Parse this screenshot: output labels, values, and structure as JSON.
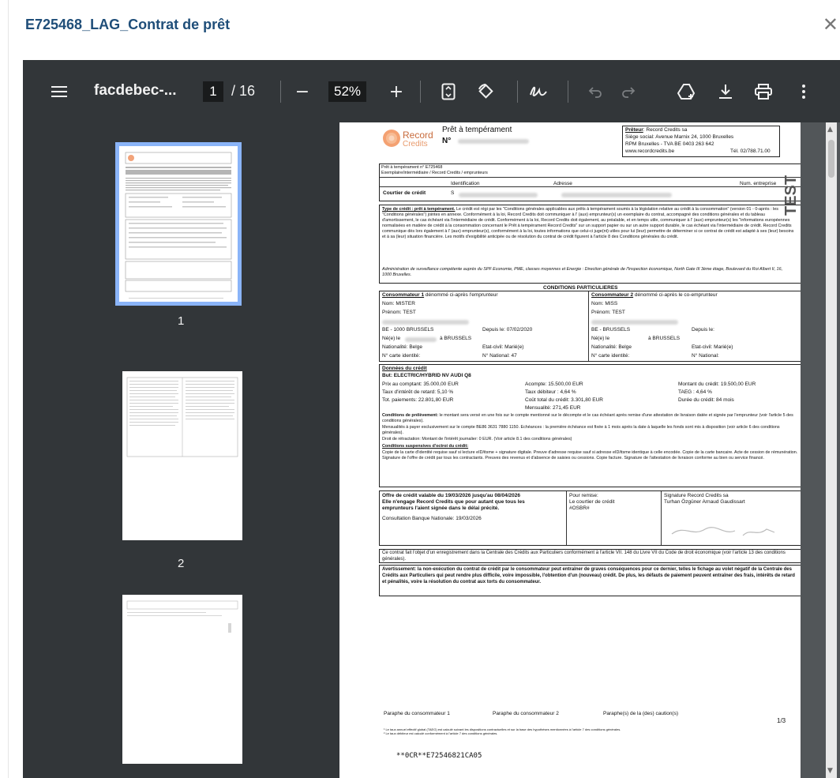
{
  "modal": {
    "title": "E725468_LAG_Contrat de prêt",
    "close_glyph": "✕"
  },
  "toolbar": {
    "menu_icon": "menu-icon",
    "file_name": "facdebec-...",
    "current_page": "1",
    "total_pages": "/ 16",
    "zoom_out": "−",
    "zoom": "52%",
    "zoom_in": "+",
    "icons": [
      "fit-page-icon",
      "rotate-icon",
      "draw-icon",
      "undo-icon",
      "redo-icon",
      "save-drive-icon",
      "download-icon",
      "print-icon",
      "more-icon"
    ]
  },
  "thumbnails": [
    {
      "label": "1",
      "selected": true
    },
    {
      "label": "2",
      "selected": false
    }
  ],
  "doc": {
    "logo": {
      "brand": "Record",
      "brand2": "Credits"
    },
    "heading": "Prêt à tempérament",
    "number_prefix": "N°",
    "lender": {
      "label": "Prêteur",
      "name": ": Record Credits sa",
      "address": "Siège social: Avenue Marnix 24, 1000 Bruxelles",
      "rpm": "RPM Bruxelles - TVA BE 0403 263 642",
      "web": "www.recordcredits.be",
      "tel": "Tél. 02/788.71.00"
    },
    "copy_line1": "Prêt à tempérament n° E725468",
    "copy_line2": "Exemplaire/intermédiaire / Record Credits / emprunteurs",
    "broker": {
      "col_id": "Identification",
      "col_address": "Adresse",
      "col_num": "Num. entreprise",
      "label": "Courtier de crédit",
      "id_value": "S"
    },
    "credit_type": {
      "title": "Type de crédit : prêt à tempérament.",
      "text": "Le crédit est régi par les \"Conditions générales applicables aux prêts à tempérament soumis à la législation relative au crédit à la consommation\" (version 01 - 0-après : les \"Conditions générales\") jointes en annexe. Conformément à la loi, Record Credits doit communiquer à l' (aux) emprunteur(s) un exemplaire du contrat, accompagné des conditions générales et du tableau d'amortissement, le cas échéant via l'intermédiaire de crédit. Conformément à la loi, Record Credits doit également, au préalable, et en temps utile, communiquer à l' (aux) emprunteur(s) les \"informations européennes normalisées en matière de crédit à la consommation concernant le Prêt à tempérament Record Credits\" sur un support papier ou sur un autre support durable, le cas échéant via l'intermédiaire de crédit. Record Credits communique dès lors également à l' (aux) emprunteur(s), conformément à la loi, toutes informations que celui-ci juge(nt) utiles pour lui (leur) permettre de déterminer si ce contrat de crédit est adapté à ses (leur) besoins et à sa (leur) situation financière. Les motifs d'exigibilité anticipée ou de résolution du contrat de crédit figurent à l'article 8 des Conditions générales du crédit.",
      "supervision": "Administration de surveillance compétente auprès du SPF Economie, PME, classes moyennes et Energie : Direction générale de l'Inspection économique, North Gate III 3ème étage, Boulevard du Roi Albert II, 16, 1000 Bruxelles."
    },
    "watermark": "TEST",
    "special_conditions": "CONDITIONS PARTICULIERES",
    "consumer1": {
      "title": "Consommateur 1",
      "desc": "dénommé ci-après l'emprunteur",
      "nom": "Nom: MISTER",
      "prenom": "Prénom: TEST",
      "city": "BE - 1000 BRUSSELS",
      "since": "Depuis le: 07/02/2020",
      "born": "Né(e) le",
      "born_city": "à BRUSSELS",
      "nationality": "Nationalité: Belge",
      "civil": "Etat-civil: Marié(e)",
      "id_card": "N° carte identité:",
      "national": "N° National: 47"
    },
    "consumer2": {
      "title": "Consommateur 2",
      "desc": "dénommé ci-après le co-emprunteur",
      "nom": "Nom: MISS",
      "prenom": "Prénom: TEST",
      "city": "BE - BRUSSELS",
      "since": "Depuis le:",
      "born": "Né(e) le",
      "born_city": "à BRUSSELS",
      "nationality": "Nationalité: Belge",
      "civil": "Etat-civil: Marié(e)",
      "id_card": "N° carte identité:",
      "national": "N° National:"
    },
    "credit_data": {
      "title": "Données du crédit",
      "goal": "But: ELECTRIC/HYBRID NV AUDI Q8",
      "cash_price": "Prix au comptant: 35.000,00 EUR",
      "deposit": "Acompte: 15.500,00 EUR",
      "amount": "Montant du crédit: 19.500,00 EUR",
      "late_rate": "Taux d'intérêt de retard: 5,10 %",
      "debit_rate": "Taux débiteur : 4,64 %",
      "taeg": "TAEG : 4,64 %",
      "total_pay": "Tot. paiements: 22.801,80 EUR",
      "total_cost": "Coût total du crédit: 3.301,80 EUR",
      "duration": "Durée du crédit: 84 mois",
      "monthly": "Mensualité: 271,45 EUR",
      "withdrawal_title": "Conditions de prélèvement:",
      "withdrawal_text": "le montant sera versé en une fois sur le compte mentionné sur le décompte et le cas échéant après remise d'une attestation de livraison datée et signée par l'emprunteur (voir l'article 5 des conditions générales).",
      "monthly_pay": "Mensualités à payer exclusivement sur le compte BE86 3631 7880 1150. Echéances : la première échéance est fixée à 1 mois après la date à laquelle les fonds sont mis à disposition (voir article 6 des conditions générales).",
      "retract": "Droit de rétractation: Montant de l'intérêt journalier: 0 EUR. (Voir article 8.1 des conditions générales)",
      "suspensive_title": "Conditions suspensives d'octroi du crédit:",
      "suspensive_text": "Copie de la carte d'identité requise sauf si lecture eID/itsme + signature digitale. Preuve d'adresse requise sauf si adresse eID/itsme identique à celle encodée. Copie de la carte bancaire. Acte de cession de rémunération. Signature de l'offre de crédit par tous les contractants. Preuves des revenus et d'absence de saisies ou cessions. Copie facture. Signature de l'attestation de livraison conforme au bien ou service financé."
    },
    "offer": {
      "line1": "Offre de crédit valable du 19/03/2026 jusqu'au 08/04/2026",
      "line2": "Elle n'engage Record Credits que pour autant que tous les",
      "line3": "emprunteurs l'aient signée dans le délai précité.",
      "consult": "Consultation Banque Nationale: 19/03/2026",
      "remit_label": "Pour remise:",
      "remit_broker": "Le courtier de crédit",
      "remit_code": "#OSBR#",
      "sign_label": "Signature Record Credits sa",
      "signers": "Turhan Özgüner    Arnaud Gaudissart"
    },
    "central": "Ce contrat fait l'objet d'un enregistrement dans la Centrale des Crédits aux Particuliers conformément à l'article VII. 148 du Livre VII du Code de droit économique (voir l'article 13 des conditions générales).",
    "warning": "Avertissement: la non-exécution du contrat de crédit par le consommateur peut entraîner de graves conséquences pour ce dernier, telles le fichage au volet négatif de la Centrale des Crédits aux Particuliers qui peut rendre plus difficile, voire impossible, l'obtention d'un (nouveau) crédit. De plus, les défauts de paiement peuvent entraîner des frais, intérêts de retard et pénalités, voire la résolution du contrat aux torts du consommateur.",
    "footer": {
      "p1": "Paraphe du consommateur 1",
      "p2": "Paraphe du consommateur 2",
      "p3": "Paraphe(s) de la (des) caution(s)",
      "page": "1/3",
      "note1": "¹ Le taux annuel effectif global (TAEG) est calculé suivant les dispositions contractuelles et sur la base des hypothèses mentionnées à l'article 7 des conditions générales.",
      "note2": "² Le taux débiteur est calculé conformément à l'article 7 des conditions générales.",
      "ocr": "**0CR**E72546821CA05"
    }
  },
  "colors": {
    "title": "#1f4e79",
    "toolbar": "#323639",
    "canvas": "#525659",
    "selected": "#8ab4f8"
  }
}
